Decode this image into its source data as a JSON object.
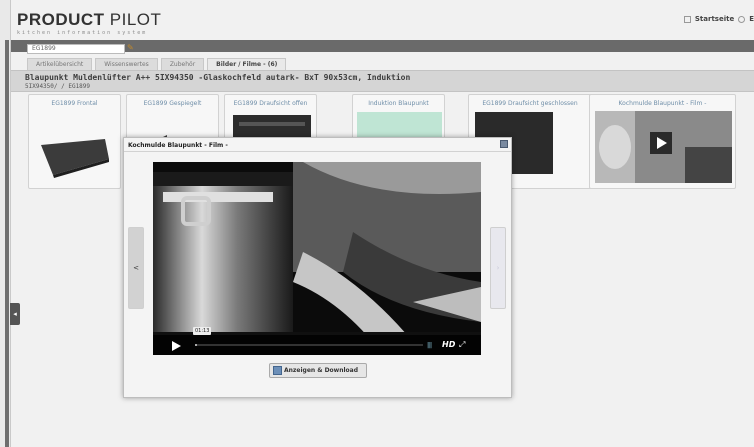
{
  "brand": {
    "logo_bold": "PRODUCT",
    "logo_light": " PILOT",
    "tagline": "kitchen information system"
  },
  "top_links": {
    "home": "Startseite",
    "second": "E"
  },
  "search": {
    "value": "EG1899"
  },
  "tabs": [
    {
      "label": "Artikelübersicht",
      "active": false
    },
    {
      "label": "Wissenswertes",
      "active": false
    },
    {
      "label": "Zubehör",
      "active": false
    },
    {
      "label": "Bilder / Filme - (6)",
      "active": true
    }
  ],
  "product": {
    "title": "Blaupunkt Muldenlüfter A++ 5IX94350 -Glaskochfeld autark- BxT 90x53cm, Induktion",
    "subtitle": "5IX94350/ / EG1899"
  },
  "gallery": [
    {
      "label": "EG1899 Frontal"
    },
    {
      "label": "EG1899 Gespiegelt"
    },
    {
      "label": "EG1899 Draufsicht offen"
    },
    {
      "label": "Induktion Blaupunkt"
    },
    {
      "label": "EG1899 Draufsicht geschlossen"
    },
    {
      "label": "Kochmulde Blaupunkt - Film -"
    }
  ],
  "modal": {
    "title": "Kochmulde Blaupunkt - Film -",
    "prev_label": "<",
    "video": {
      "time": "01:13",
      "progress": 0.01,
      "hd": "HD"
    },
    "download_label": "Anzeigen & Download"
  },
  "colors": {
    "header_bar": "#6a6a6a",
    "link": "#6f8ea8",
    "accent": "#c48a2a"
  }
}
